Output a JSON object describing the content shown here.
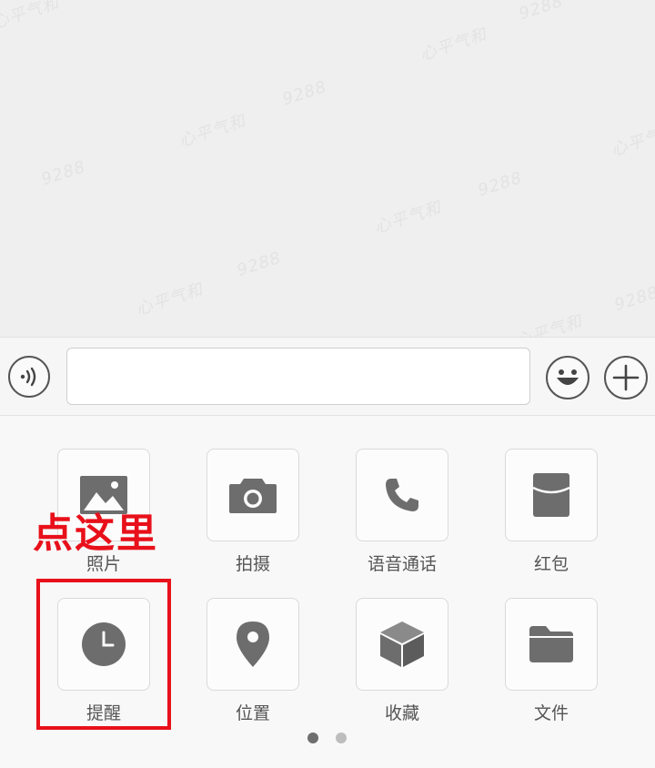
{
  "watermark": [
    "心平气和",
    "9288"
  ],
  "toolbar": {
    "voice_icon": "voice-wave-icon",
    "emoji_icon": "smiley-icon",
    "more_icon": "plus-icon",
    "input_value": ""
  },
  "grid": {
    "items": [
      {
        "label": "照片",
        "icon": "photo-icon"
      },
      {
        "label": "拍摄",
        "icon": "camera-icon"
      },
      {
        "label": "语音通话",
        "icon": "phone-icon"
      },
      {
        "label": "红包",
        "icon": "red-envelope-icon"
      },
      {
        "label": "提醒",
        "icon": "clock-icon"
      },
      {
        "label": "位置",
        "icon": "location-pin-icon"
      },
      {
        "label": "收藏",
        "icon": "cube-icon"
      },
      {
        "label": "文件",
        "icon": "folder-icon"
      }
    ]
  },
  "pager": {
    "pages": 2,
    "current": 1
  },
  "annotation": {
    "text": "点这里",
    "color": "#e8101a"
  }
}
